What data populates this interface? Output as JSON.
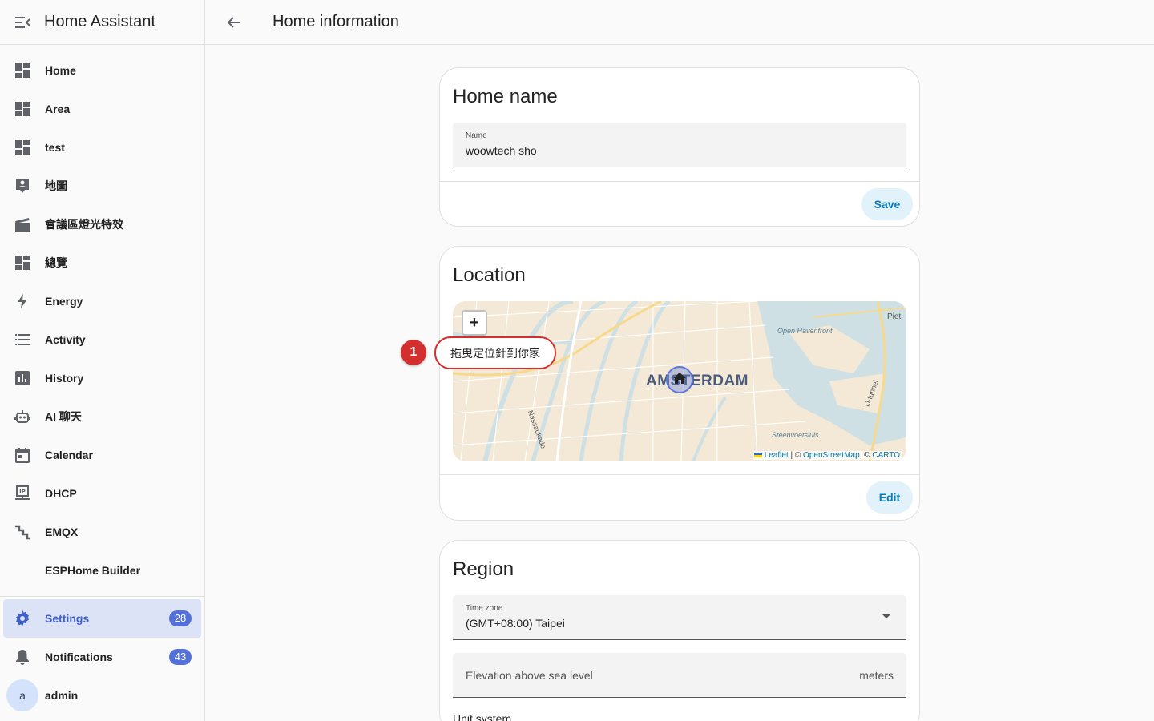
{
  "app": {
    "title": "Home Assistant"
  },
  "sidebar": {
    "items": [
      {
        "label": "Home",
        "icon": "dashboard-icon"
      },
      {
        "label": "Area",
        "icon": "dashboard-icon"
      },
      {
        "label": "test",
        "icon": "dashboard-icon"
      },
      {
        "label": "地圖",
        "icon": "account-box-icon"
      },
      {
        "label": "會議區燈光特效",
        "icon": "movie-clapper-icon"
      },
      {
        "label": "總覽",
        "icon": "dashboard-icon"
      },
      {
        "label": "Energy",
        "icon": "lightning-icon"
      },
      {
        "label": "Activity",
        "icon": "list-icon"
      },
      {
        "label": "History",
        "icon": "chart-box-icon"
      },
      {
        "label": "AI 聊天",
        "icon": "robot-icon"
      },
      {
        "label": "Calendar",
        "icon": "calendar-icon"
      },
      {
        "label": "DHCP",
        "icon": "ip-network-icon"
      },
      {
        "label": "EMQX",
        "icon": "stairs-icon"
      },
      {
        "label": "ESPHome Builder",
        "icon": ""
      }
    ],
    "settings": {
      "label": "Settings",
      "badge": "28"
    },
    "notifications": {
      "label": "Notifications",
      "badge": "43"
    },
    "user": {
      "label": "admin",
      "avatar": "a"
    }
  },
  "header": {
    "title": "Home information"
  },
  "home_name": {
    "title": "Home name",
    "field_label": "Name",
    "field_value": "woowtech sho",
    "save_label": "Save"
  },
  "location": {
    "title": "Location",
    "zoom_label": "+",
    "map_labels": {
      "city": "AMSTERDAM",
      "havenfront": "Open Havenfront",
      "piet": "Piet",
      "tunnel": "IJ-tunnel",
      "steenvoetsluis": "Steenvoetsluis",
      "nassaukade": "Nassaukade"
    },
    "attribution": {
      "leaflet": "Leaflet",
      "sep1": " | © ",
      "osm": "OpenStreetMap",
      "sep2": ", © ",
      "carto": "CARTO"
    },
    "edit_label": "Edit"
  },
  "callout": {
    "number": "1",
    "text": "拖曳定位針到你家"
  },
  "region": {
    "title": "Region",
    "timezone_label": "Time zone",
    "timezone_value": "(GMT+08:00) Taipei",
    "elevation_placeholder": "Elevation above sea level",
    "elevation_suffix": "meters",
    "unit_system_label": "Unit system"
  },
  "colors": {
    "accent": "#3f5fc9",
    "badge": "#5470d9",
    "button_bg": "#e1f2fb",
    "button_text": "#0a7bb5",
    "callout": "#d32f2f"
  }
}
